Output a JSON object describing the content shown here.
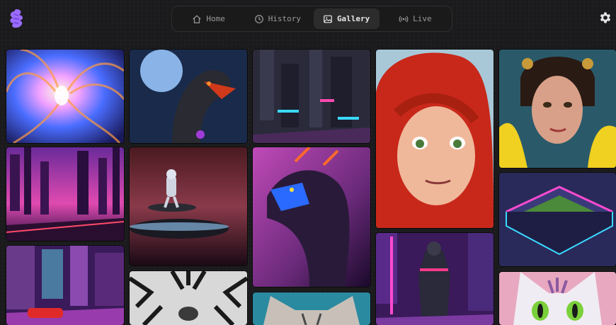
{
  "app": {
    "logo_icon": "purple-blob-logo",
    "settings_icon": "gear-icon"
  },
  "nav": {
    "tabs": [
      {
        "label": "Home",
        "icon": "home-icon",
        "active": false
      },
      {
        "label": "History",
        "icon": "history-icon",
        "active": false
      },
      {
        "label": "Gallery",
        "icon": "image-icon",
        "active": true
      },
      {
        "label": "Live",
        "icon": "broadcast-icon",
        "active": false
      }
    ]
  },
  "gallery": {
    "accent": "#9b6bff",
    "images": [
      {
        "id": "phoenix",
        "subject": "white phoenix with rainbow feathers"
      },
      {
        "id": "dragon-moon",
        "subject": "mechanical dragon before a full moon"
      },
      {
        "id": "cyber-city-1",
        "subject": "neon cyberpunk cityscape"
      },
      {
        "id": "red-hair-girl",
        "subject": "red-haired animated girl"
      },
      {
        "id": "warrior-woman",
        "subject": "woman with ornate headpiece and yellow flowers"
      },
      {
        "id": "neon-skyline",
        "subject": "pink neon skyline with road"
      },
      {
        "id": "astronaut-ufo",
        "subject": "astronaut on flying saucer"
      },
      {
        "id": "neon-dragon",
        "subject": "neon-lit dragon head"
      },
      {
        "id": "stadium",
        "subject": "isometric neon stadium"
      },
      {
        "id": "neon-street-car",
        "subject": "neon city street with red car"
      },
      {
        "id": "tiger",
        "subject": "tiger face"
      },
      {
        "id": "cat",
        "subject": "tabby cat portrait"
      },
      {
        "id": "samurai",
        "subject": "neon armored samurai"
      },
      {
        "id": "cartoon-cat",
        "subject": "cartoon cat with green eyes"
      }
    ]
  }
}
